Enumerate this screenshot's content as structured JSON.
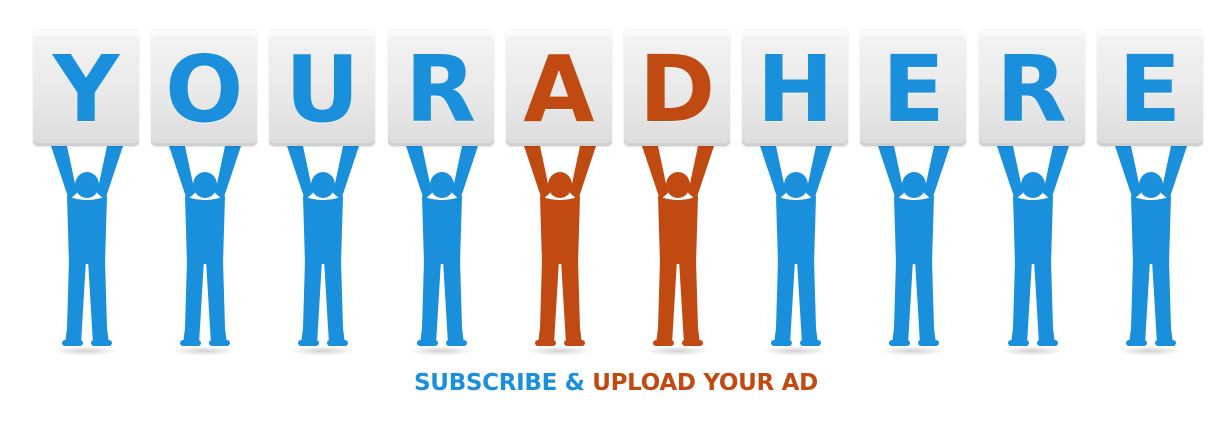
{
  "colors": {
    "blue": "#1a8fdb",
    "orange": "#c14a12"
  },
  "blocks": [
    {
      "letter": "Y",
      "color": "blue"
    },
    {
      "letter": "O",
      "color": "blue"
    },
    {
      "letter": "U",
      "color": "blue"
    },
    {
      "letter": "R",
      "color": "blue"
    },
    {
      "letter": "A",
      "color": "orange"
    },
    {
      "letter": "D",
      "color": "orange"
    },
    {
      "letter": "H",
      "color": "blue"
    },
    {
      "letter": "E",
      "color": "blue"
    },
    {
      "letter": "R",
      "color": "blue"
    },
    {
      "letter": "E",
      "color": "blue"
    }
  ],
  "tagline": {
    "part1": "SUBSCRIBE & ",
    "part2": "UPLOAD YOUR AD"
  }
}
